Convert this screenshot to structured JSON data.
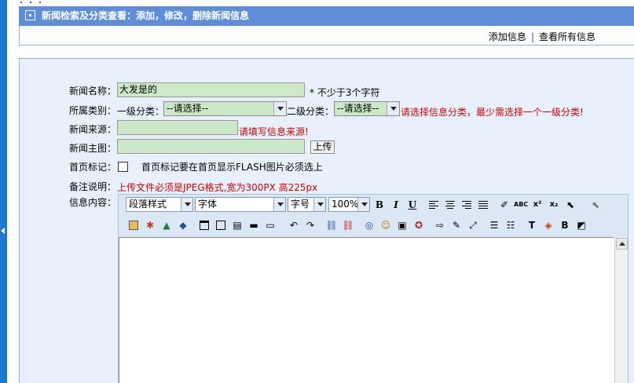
{
  "header": {
    "title": "新闻检索及分类查看：添加，修改，删除新闻信息"
  },
  "links": {
    "add": "添加信息",
    "sep": "|",
    "view_all": "查看所有信息"
  },
  "form": {
    "title_label": "新闻名称：",
    "title_value": "大发是的",
    "title_hint": "* 不少于3个字符",
    "category_label": "所属类别：",
    "level1_label": "一级分类：",
    "level1_value": "--请选择--",
    "level2_label": "二级分类：",
    "level2_value": "--请选择--",
    "category_hint": "请选择信息分类，最少需选择一个一级分类!",
    "source_label": "新闻来源：",
    "source_value": "",
    "source_hint": "请填写信息来源!",
    "image_label": "新闻主图：",
    "image_value": "",
    "upload_label": "上传",
    "home_label": "首页标记：",
    "home_hint": "首页标记要在首页显示FLASH图片必须选上",
    "note_label": "备注说明：",
    "note_text": "上传文件必须是JPEG格式,宽为300PX 高225px",
    "content_label": "信息内容："
  },
  "editor": {
    "paragraph_style": "段落样式",
    "font": "字体",
    "font_size": "字号",
    "zoom": "100%",
    "bold": "B",
    "italic": "I",
    "underline": "U",
    "abc": "ABC",
    "superscript": "x²",
    "subscript": "x₂"
  },
  "colors": {
    "accent": "#5f8ed8",
    "panel": "#e8f0fb",
    "input": "#cce8c8",
    "warning": "#d00000",
    "left_bar": "#1e78d2"
  }
}
